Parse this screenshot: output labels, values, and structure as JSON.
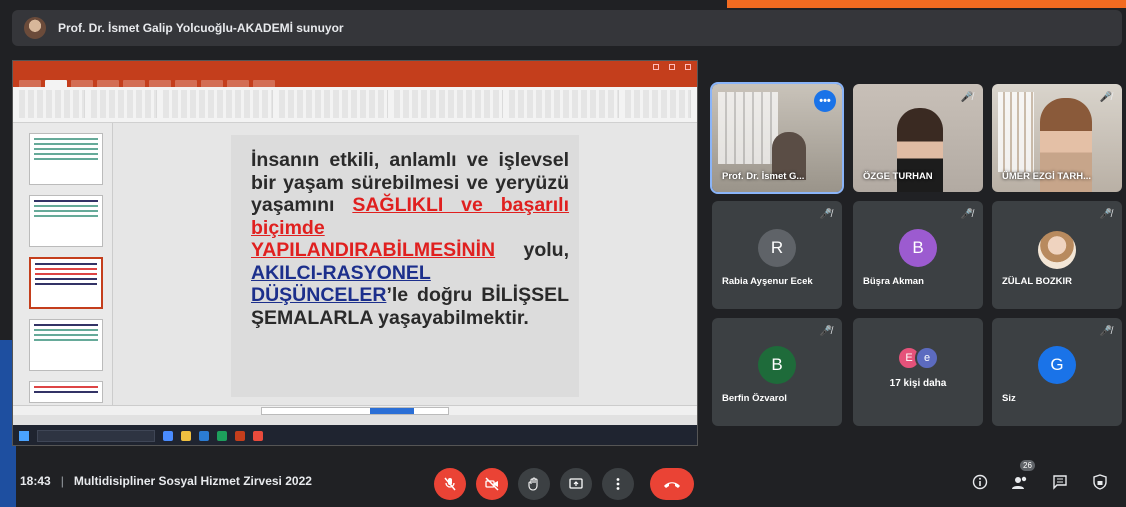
{
  "presenter": {
    "label": "Prof. Dr. İsmet Galip Yolcuoğlu-AKADEMİ sunuyor"
  },
  "slide": {
    "text_1": "İnsanın etkili, anlamlı ve işlevsel bir yaşam sürebilmesi ve yeryüzü yaşamını ",
    "red_1": "SAĞLIKLI ve başarılı biçimde YAPILANDIRABİLMESİNİN",
    "text_2": " yolu, ",
    "blue_1": "AKILCI-RASYONEL DÜŞÜNCELER",
    "text_3": "’le doğru BİLİŞSEL ŞEMALARLA yaşayabilmektir."
  },
  "participants": [
    {
      "name": "Prof. Dr. İsmet G...",
      "type": "video"
    },
    {
      "name": "ÖZGE TURHAN",
      "type": "video",
      "muted": true
    },
    {
      "name": "ÜMER EZGİ TARH...",
      "type": "video",
      "muted": true
    },
    {
      "name": "Rabia Ayşenur Ecek",
      "initial": "R",
      "color": "#5f6368",
      "muted": true
    },
    {
      "name": "Büşra Akman",
      "initial": "B",
      "color": "#9c5bd0",
      "muted": true
    },
    {
      "name": "ZÜLAL BOZKIR",
      "muted": true,
      "photo": true
    },
    {
      "name": "Berfin Özvarol",
      "initial": "B",
      "color": "#1e6b3a",
      "muted": true
    },
    {
      "name": "17 kişi daha",
      "bubbles": [
        "E",
        "e"
      ]
    },
    {
      "name": "Siz",
      "initial": "G",
      "color": "#1a73e8",
      "muted": true
    }
  ],
  "more_button": "•••",
  "bottom": {
    "time": "18:43",
    "meeting_title": "Multidisipliner Sosyal Hizmet Zirvesi 2022",
    "people_count": "26"
  },
  "colors": {
    "accent": "#f26b21",
    "end_call": "#ea4335",
    "presenting_blue": "#1a73e8"
  },
  "icons": [
    "mic-off-icon",
    "camera-off-icon",
    "raise-hand-icon",
    "present-icon",
    "more-options-icon",
    "end-call-icon",
    "info-icon",
    "people-icon",
    "chat-icon",
    "activities-icon"
  ]
}
